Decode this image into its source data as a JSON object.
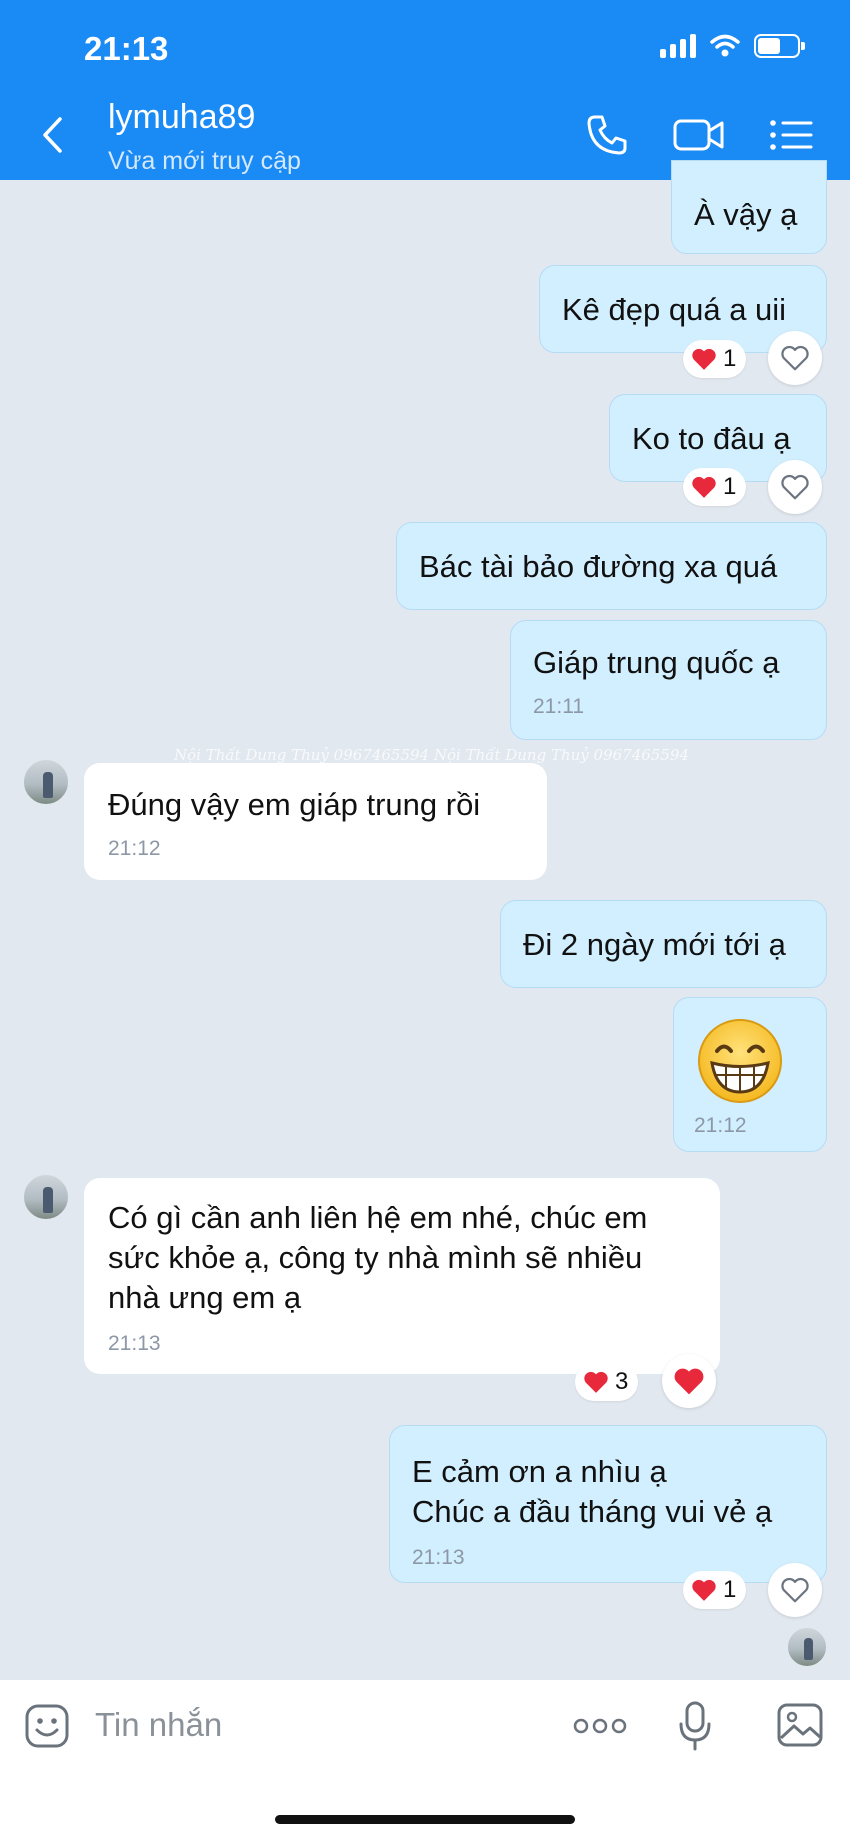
{
  "status_bar": {
    "time": "21:13"
  },
  "header": {
    "contact_name": "lymuha89",
    "contact_status": "Vừa mới truy cập"
  },
  "messages": [
    {
      "direction": "out",
      "text": "À vậy ạ"
    },
    {
      "direction": "out",
      "text": "Kê đẹp quá a uii",
      "reaction_count": "1"
    },
    {
      "direction": "out",
      "text": "Ko to đâu ạ",
      "reaction_count": "1"
    },
    {
      "direction": "out",
      "text": "Bác tài bảo đường xa quá"
    },
    {
      "direction": "out",
      "text": "Giáp trung quốc ạ",
      "time": "21:11"
    },
    {
      "direction": "in",
      "text": "Đúng vậy em giáp trung rồi",
      "time": "21:12"
    },
    {
      "direction": "out",
      "text": "Đi 2 ngày mới tới ạ"
    },
    {
      "direction": "out",
      "emoji": "grinning-face",
      "time": "21:12"
    },
    {
      "direction": "in",
      "lines": [
        "Có gì cần anh liên hệ em nhé, chúc em",
        "sức khỏe ạ, công ty nhà mình sẽ nhiều",
        "nhà ưng em ạ"
      ],
      "time": "21:13",
      "reaction_count": "3"
    },
    {
      "direction": "out",
      "lines": [
        "E cảm ơn a nhìu ạ",
        "Chúc a đầu tháng vui vẻ ạ"
      ],
      "time": "21:13",
      "reaction_count": "1"
    }
  ],
  "watermark": "Nội Thất Dung Thuỷ 0967465594 Nội Thất Dung Thuỷ 0967465594",
  "input_bar": {
    "placeholder": "Tin nhắn"
  },
  "colors": {
    "header_bg": "#1a8bf5",
    "outgoing_bubble": "#d2efff",
    "incoming_bubble": "#ffffff",
    "chat_bg": "#e2e8ef",
    "heart": "#e8293b"
  }
}
